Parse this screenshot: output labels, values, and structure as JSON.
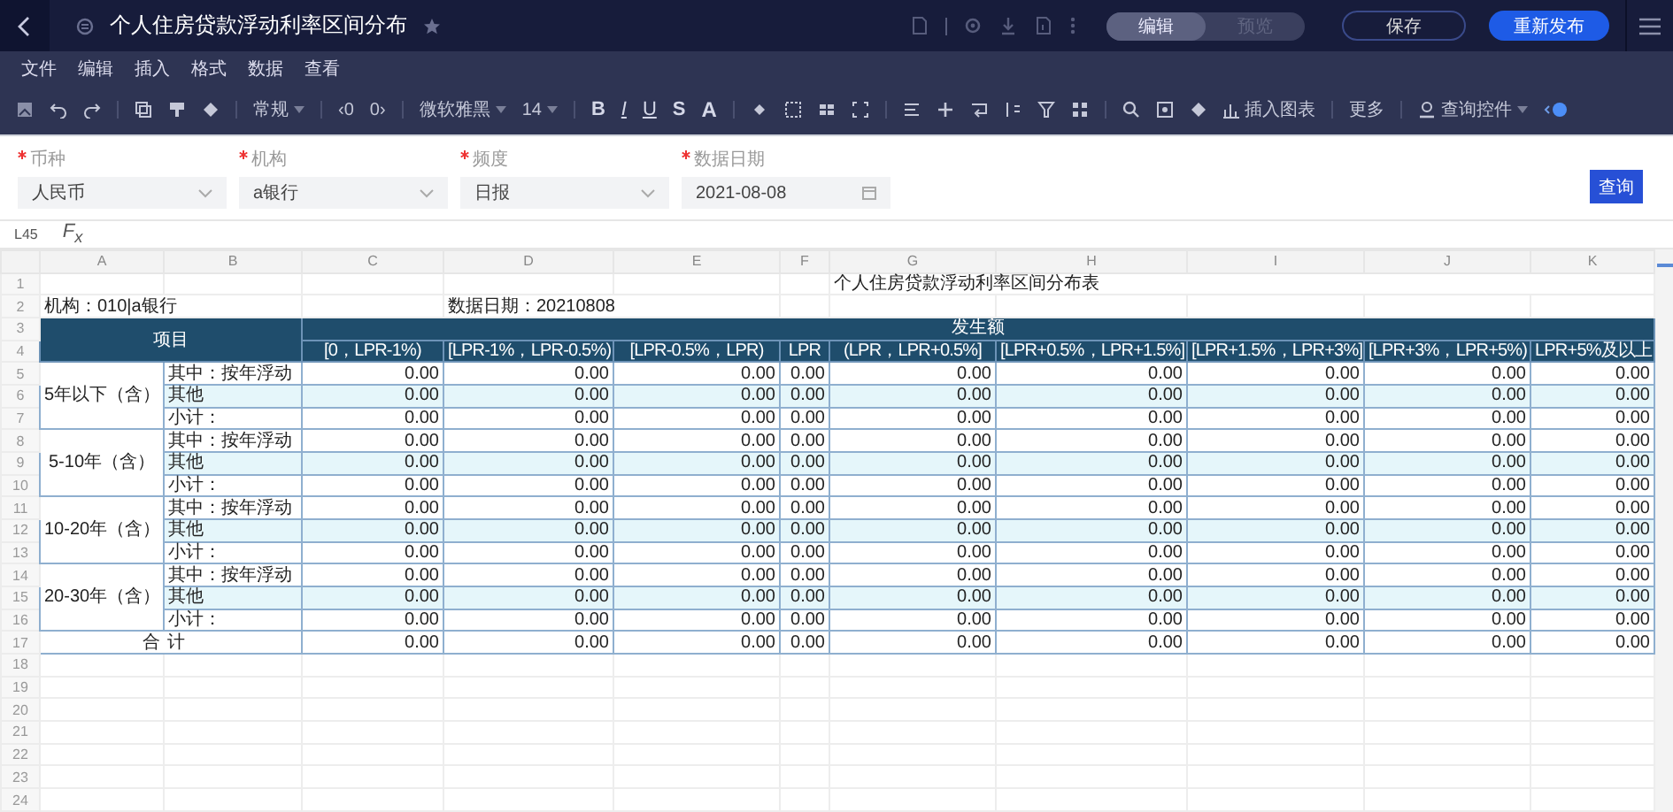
{
  "window": {
    "title": "个人住房贷款浮动利率区间分布",
    "mode_tabs": [
      {
        "label": "编辑",
        "selected": true
      },
      {
        "label": "预览",
        "selected": false
      }
    ],
    "save_button": "保存",
    "publish_button": "重新发布"
  },
  "menu": [
    "文件",
    "编辑",
    "插入",
    "格式",
    "数据",
    "查看"
  ],
  "toolbar": {
    "number_format": "常规",
    "decimal_buttons": [
      "‹0",
      "0›"
    ],
    "font": "微软雅黑",
    "font_size": "14",
    "text_styles": [
      {
        "label": "B",
        "kind": "bold"
      },
      {
        "label": "I",
        "kind": "italic"
      },
      {
        "label": "U",
        "kind": "underline"
      },
      {
        "label": "S",
        "kind": "strike"
      },
      {
        "label": "A",
        "kind": "color"
      }
    ],
    "insert_chart": "插入图表",
    "more": "更多",
    "query_control": "查询控件"
  },
  "filters": [
    {
      "label": "币种",
      "required": true,
      "value": "人民币",
      "kind": "select"
    },
    {
      "label": "机构",
      "required": true,
      "value": "a银行",
      "kind": "select"
    },
    {
      "label": "频度",
      "required": true,
      "value": "日报",
      "kind": "select"
    },
    {
      "label": "数据日期",
      "required": true,
      "value": "2021-08-08",
      "kind": "date"
    }
  ],
  "query_button": "查询",
  "formula_bar": {
    "cell": "L45",
    "fx": "F$_{x}$"
  },
  "sheet": {
    "columns": [
      "A",
      "B",
      "C",
      "D",
      "E",
      "F",
      "G",
      "H",
      "I",
      "J",
      "K"
    ],
    "row_numbers": [
      "1",
      "2",
      "3",
      "4",
      "5",
      "6",
      "7",
      "8",
      "9",
      "10",
      "11",
      "12",
      "13",
      "14",
      "15",
      "16",
      "17",
      "18",
      "19",
      "20",
      "21",
      "22",
      "23",
      "24"
    ],
    "title": "个人住房贷款浮动利率区间分布表",
    "org": "机构：010|a银行",
    "date": "数据日期：20210808",
    "item_header": "项目",
    "amount_header": "发生额",
    "interval_headers": [
      "[0，LPR-1%)",
      "[LPR-1%，LPR-0.5%)",
      "[LPR-0.5%，LPR)",
      "LPR",
      "(LPR，LPR+0.5%]",
      "[LPR+0.5%，LPR+1.5%]",
      "[LPR+1.5%，LPR+3%]",
      "[LPR+3%，LPR+5%)",
      "LPR+5%及以上"
    ],
    "groups": [
      {
        "label": "5年以下（含）",
        "rows": [
          {
            "label": "其中：按年浮动",
            "kind": "plain",
            "values": [
              "0.00",
              "0.00",
              "0.00",
              "0.00",
              "0.00",
              "0.00",
              "0.00",
              "0.00",
              "0.00"
            ]
          },
          {
            "label": "其他",
            "kind": "shaded",
            "values": [
              "0.00",
              "0.00",
              "0.00",
              "0.00",
              "0.00",
              "0.00",
              "0.00",
              "0.00",
              "0.00"
            ]
          },
          {
            "label": "小计：",
            "kind": "plain",
            "values": [
              "0.00",
              "0.00",
              "0.00",
              "0.00",
              "0.00",
              "0.00",
              "0.00",
              "0.00",
              "0.00"
            ]
          }
        ]
      },
      {
        "label": "5-10年（含）",
        "rows": [
          {
            "label": "其中：按年浮动",
            "kind": "plain",
            "values": [
              "0.00",
              "0.00",
              "0.00",
              "0.00",
              "0.00",
              "0.00",
              "0.00",
              "0.00",
              "0.00"
            ]
          },
          {
            "label": "其他",
            "kind": "shaded",
            "values": [
              "0.00",
              "0.00",
              "0.00",
              "0.00",
              "0.00",
              "0.00",
              "0.00",
              "0.00",
              "0.00"
            ]
          },
          {
            "label": "小计：",
            "kind": "plain",
            "values": [
              "0.00",
              "0.00",
              "0.00",
              "0.00",
              "0.00",
              "0.00",
              "0.00",
              "0.00",
              "0.00"
            ]
          }
        ]
      },
      {
        "label": "10-20年（含）",
        "rows": [
          {
            "label": "其中：按年浮动",
            "kind": "plain",
            "values": [
              "0.00",
              "0.00",
              "0.00",
              "0.00",
              "0.00",
              "0.00",
              "0.00",
              "0.00",
              "0.00"
            ]
          },
          {
            "label": "其他",
            "kind": "shaded",
            "values": [
              "0.00",
              "0.00",
              "0.00",
              "0.00",
              "0.00",
              "0.00",
              "0.00",
              "0.00",
              "0.00"
            ]
          },
          {
            "label": "小计：",
            "kind": "plain",
            "values": [
              "0.00",
              "0.00",
              "0.00",
              "0.00",
              "0.00",
              "0.00",
              "0.00",
              "0.00",
              "0.00"
            ]
          }
        ]
      },
      {
        "label": "20-30年（含）",
        "rows": [
          {
            "label": "其中：按年浮动",
            "kind": "plain",
            "values": [
              "0.00",
              "0.00",
              "0.00",
              "0.00",
              "0.00",
              "0.00",
              "0.00",
              "0.00",
              "0.00"
            ]
          },
          {
            "label": "其他",
            "kind": "shaded",
            "values": [
              "0.00",
              "0.00",
              "0.00",
              "0.00",
              "0.00",
              "0.00",
              "0.00",
              "0.00",
              "0.00"
            ]
          },
          {
            "label": "小计：",
            "kind": "plain",
            "values": [
              "0.00",
              "0.00",
              "0.00",
              "0.00",
              "0.00",
              "0.00",
              "0.00",
              "0.00",
              "0.00"
            ]
          }
        ]
      }
    ],
    "total": {
      "labels": [
        "合",
        "计"
      ],
      "values": [
        "0.00",
        "0.00",
        "0.00",
        "0.00",
        "0.00",
        "0.00",
        "0.00",
        "0.00",
        "0.00"
      ]
    }
  }
}
